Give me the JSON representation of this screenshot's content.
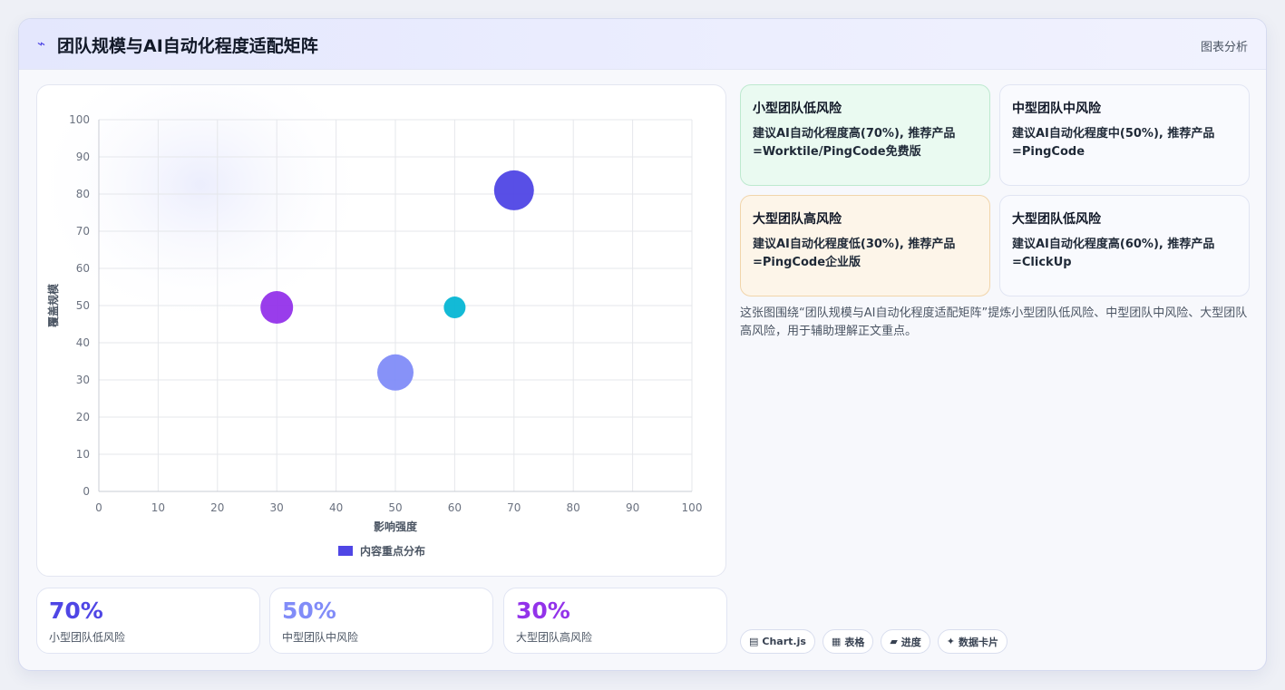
{
  "header": {
    "icon": "lightning-icon",
    "title": "团队规模与AI自动化程度适配矩阵",
    "tag": "图表分析"
  },
  "chart_data": {
    "type": "bubble",
    "xlabel": "影响强度",
    "ylabel": "覆盖规模",
    "xlim": [
      0,
      100
    ],
    "ylim": [
      0,
      100
    ],
    "x_ticks": [
      0,
      10,
      20,
      30,
      40,
      50,
      60,
      70,
      80,
      90,
      100
    ],
    "y_ticks": [
      0,
      10,
      20,
      30,
      40,
      50,
      60,
      70,
      80,
      90,
      100
    ],
    "grid": true,
    "legend": "bottom",
    "series": [
      {
        "name": "内容重点分布",
        "legend_color": "#4f46e5",
        "points": [
          {
            "x": 70,
            "y": 81,
            "r": 22,
            "color": "#4f46e5"
          },
          {
            "x": 30,
            "y": 49.5,
            "r": 18,
            "color": "#9333ea"
          },
          {
            "x": 60,
            "y": 49.5,
            "r": 12,
            "color": "#06b6d4"
          },
          {
            "x": 50,
            "y": 32,
            "r": 20,
            "color": "#818cf8"
          }
        ]
      }
    ]
  },
  "stats": [
    {
      "value": "70%",
      "label": "小型团队低风险",
      "color": "#4f46e5"
    },
    {
      "value": "50%",
      "label": "中型团队中风险",
      "color": "#818cf8"
    },
    {
      "value": "30%",
      "label": "大型团队高风险",
      "color": "#9333ea"
    }
  ],
  "cards": [
    {
      "title": "小型团队低风险",
      "desc": "建议AI自动化程度高(70%), 推荐产品 =Worktile/PingCode免费版"
    },
    {
      "title": "中型团队中风险",
      "desc": "建议AI自动化程度中(50%), 推荐产品 =PingCode"
    },
    {
      "title": "大型团队高风险",
      "desc": "建议AI自动化程度低(30%), 推荐产品 =PingCode企业版"
    },
    {
      "title": "大型团队低风险",
      "desc": "建议AI自动化程度高(60%), 推荐产品 =ClickUp"
    }
  ],
  "summary": "这张图围绕“团队规模与AI自动化程度适配矩阵”提炼小型团队低风险、中型团队中风险、大型团队高风险，用于辅助理解正文重点。",
  "chips": [
    {
      "icon": "chart-icon",
      "glyph": "▤",
      "label": "Chart.js"
    },
    {
      "icon": "table-icon",
      "glyph": "▦",
      "label": "表格"
    },
    {
      "icon": "progress-icon",
      "glyph": "▰",
      "label": "进度"
    },
    {
      "icon": "card-icon",
      "glyph": "✦",
      "label": "数据卡片"
    }
  ]
}
